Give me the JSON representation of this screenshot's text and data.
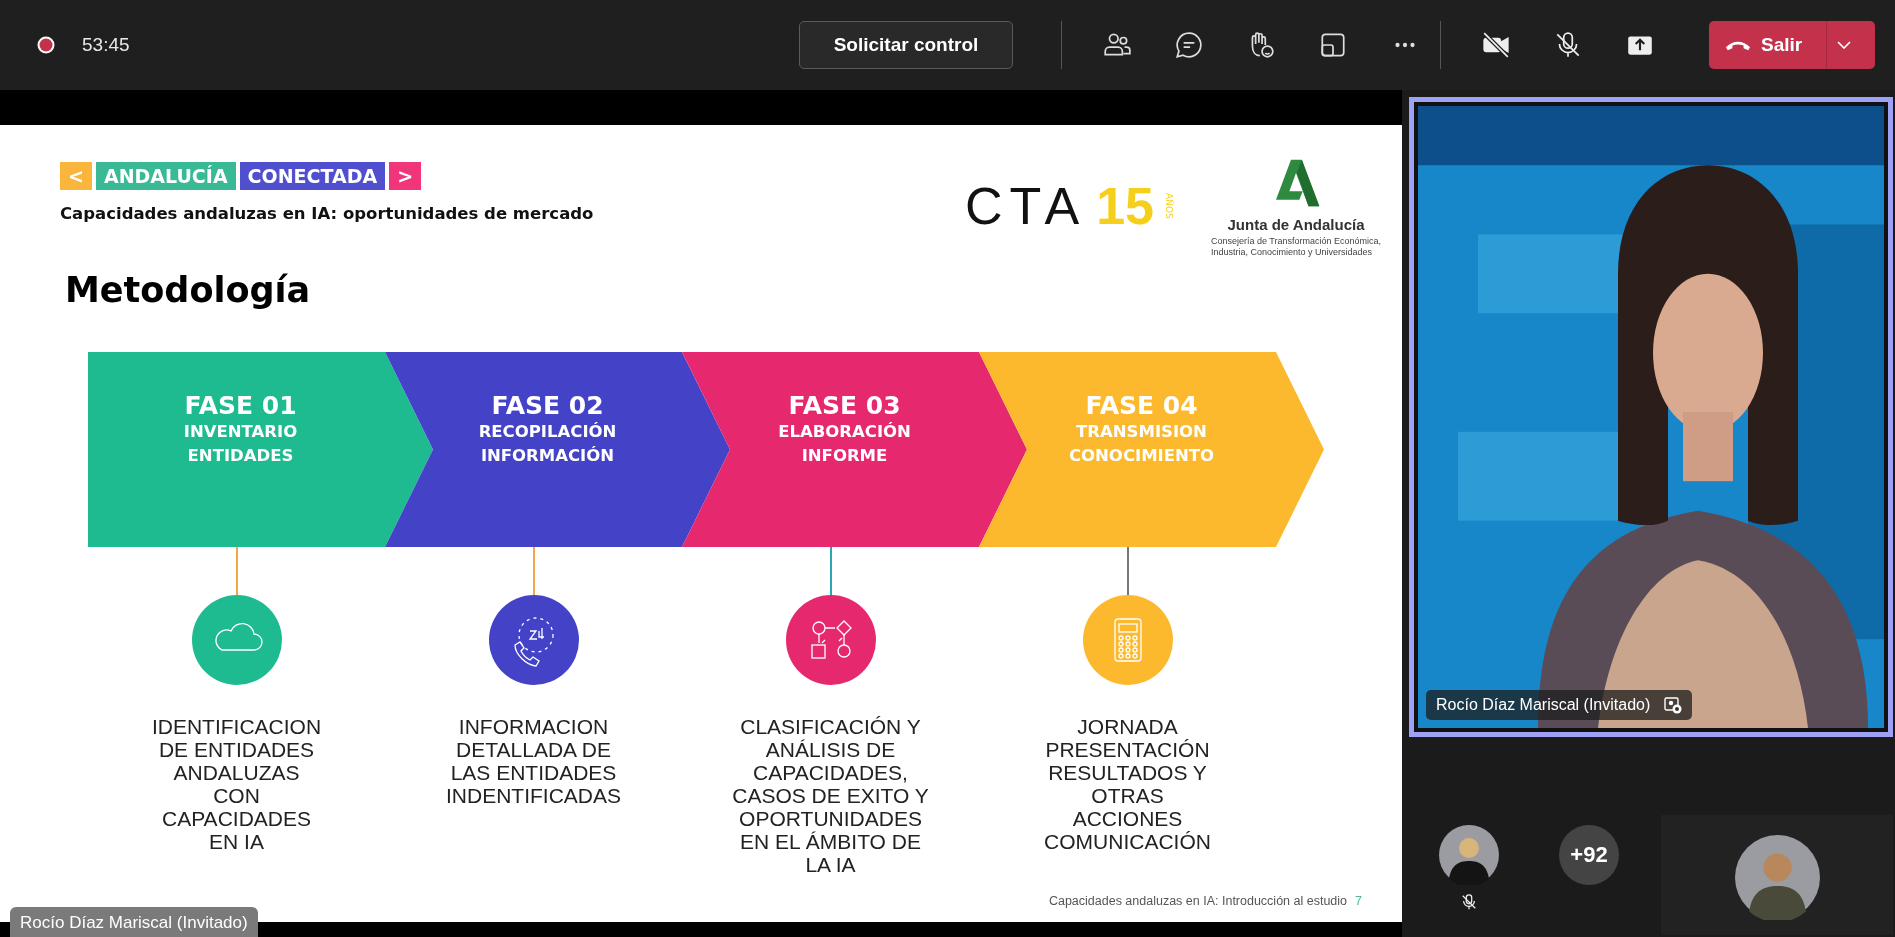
{
  "toolbar": {
    "recording": true,
    "timer": "53:45",
    "control_button": "Solicitar control",
    "camera_on": false,
    "mic_on": false,
    "leave_button": "Salir"
  },
  "slide": {
    "tags": [
      {
        "text": "<",
        "color": "#f9b53c"
      },
      {
        "text": "ANDALUCÍA",
        "color": "#3ab996"
      },
      {
        "text": "CONECTADA",
        "color": "#4f4fcf"
      },
      {
        "text": ">",
        "color": "#f0357a"
      }
    ],
    "subtitle": "Capacidades andaluzas en IA: oportunidades de mercado",
    "cta_logo": {
      "letters": "CTA",
      "years": "15",
      "years_label": "AÑOS"
    },
    "gov_logo": {
      "name": "Junta de Andalucía",
      "department": [
        "Consejería de Transformación Económica,",
        "Industria, Conocimiento y Universidades"
      ]
    },
    "heading": "Metodología",
    "phases": [
      {
        "title": "FASE 01",
        "subtitle": [
          "INVENTARIO",
          "ENTIDADES"
        ],
        "color": "#1dbb8f",
        "description": [
          "IDENTIFICACION",
          "DE ENTIDADES",
          "ANDALUZAS",
          "CON",
          "CAPACIDADES",
          "EN IA"
        ]
      },
      {
        "title": "FASE 02",
        "subtitle": [
          "RECOPILACIÓN",
          "INFORMACIÓN"
        ],
        "color": "#4443c8",
        "description": [
          "INFORMACION",
          "DETALLADA DE",
          "LAS ENTIDADES",
          "INDENTIFICADAS"
        ]
      },
      {
        "title": "FASE 03",
        "subtitle": [
          "ELABORACIÓN",
          "INFORME"
        ],
        "color": "#e6296f",
        "description": [
          "CLASIFICACIÓN Y",
          "ANÁLISIS DE",
          "CAPACIDADES,",
          "CASOS DE EXITO Y",
          "OPORTUNIDADES",
          "EN EL ÁMBITO DE",
          "LA IA"
        ]
      },
      {
        "title": "FASE 04",
        "subtitle": [
          "TRANSMISION",
          "CONOCIMIENTO"
        ],
        "color": "#fdb92e",
        "description": [
          "JORNADA",
          "PRESENTACIÓN",
          "RESULTADOS Y",
          "OTRAS",
          "ACCIONES",
          "COMUNICACIÓN"
        ]
      }
    ],
    "footer": "Capacidades andaluzas en IA: Introducción al estudio",
    "page_number": "7"
  },
  "presenter_label": "Rocío Díaz Mariscal (Invitado)",
  "video": {
    "kind": "picture",
    "name": "Rocío Díaz Mariscal (Invitado)"
  },
  "participants": [
    {
      "kind": "picture",
      "muted": true
    },
    {
      "kind": "count",
      "text": "+92"
    },
    {
      "kind": "picture",
      "muted": false
    }
  ]
}
